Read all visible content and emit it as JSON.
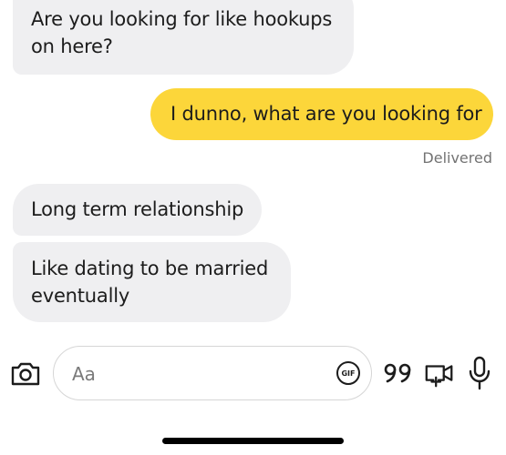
{
  "messages": [
    {
      "direction": "incoming",
      "text": "Are you looking for like hookups on here?"
    },
    {
      "direction": "outgoing",
      "text": "I dunno, what are you looking for"
    },
    {
      "direction": "incoming",
      "text": "Long term relationship"
    },
    {
      "direction": "incoming",
      "text": "Like dating to be married eventually"
    }
  ],
  "status": {
    "delivered": "Delivered"
  },
  "composer": {
    "placeholder": "Aa",
    "value": "",
    "gif_label": "GIF",
    "icons": [
      "camera-icon",
      "gif-icon",
      "quote-icon",
      "video-call-icon",
      "microphone-icon"
    ]
  },
  "colors": {
    "incoming_bubble": "#efeff1",
    "outgoing_bubble": "#fcd63a",
    "text": "#1c1c1c",
    "muted": "#737373"
  }
}
